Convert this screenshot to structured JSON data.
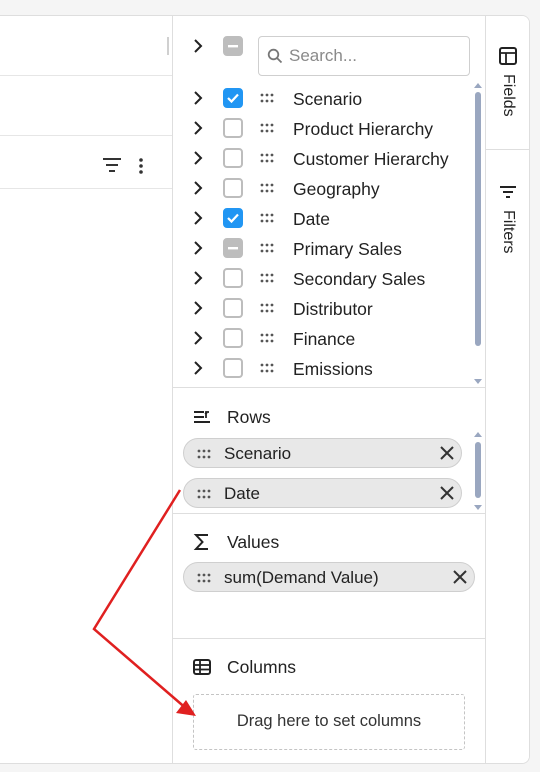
{
  "search": {
    "placeholder": "Search..."
  },
  "tree": {
    "items": [
      {
        "label": "Scenario",
        "state": "checked"
      },
      {
        "label": "Product Hierarchy",
        "state": "unchecked"
      },
      {
        "label": "Customer Hierarchy",
        "state": "unchecked"
      },
      {
        "label": "Geography",
        "state": "unchecked"
      },
      {
        "label": "Date",
        "state": "checked"
      },
      {
        "label": "Primary Sales",
        "state": "indeterminate"
      },
      {
        "label": "Secondary Sales",
        "state": "unchecked"
      },
      {
        "label": "Distributor",
        "state": "unchecked"
      },
      {
        "label": "Finance",
        "state": "unchecked"
      },
      {
        "label": "Emissions",
        "state": "unchecked"
      }
    ]
  },
  "rows": {
    "title": "Rows",
    "chips": [
      "Scenario",
      "Date"
    ]
  },
  "values": {
    "title": "Values",
    "chips": [
      "sum(Demand Value)"
    ]
  },
  "columns": {
    "title": "Columns",
    "placeholder": "Drag here to set columns"
  },
  "tabs": {
    "fields": "Fields",
    "filters": "Filters"
  },
  "colors": {
    "accent": "#2196f3",
    "annotation": "#e02020",
    "indeterminate": "#bdbdbd"
  }
}
